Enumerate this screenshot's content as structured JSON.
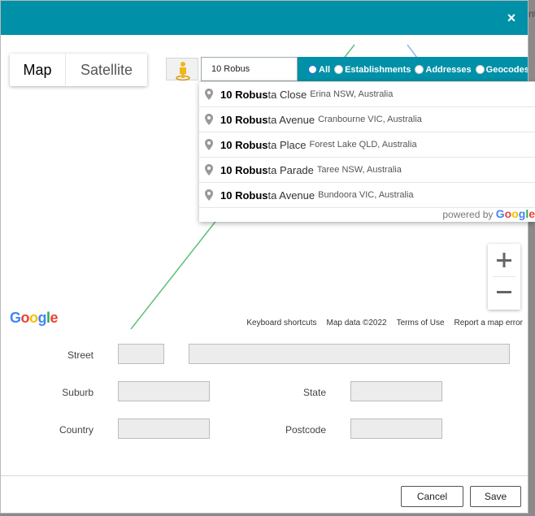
{
  "dialog": {
    "close_label": "×",
    "behind_text": "nt"
  },
  "map": {
    "maptype_map": "Map",
    "maptype_satellite": "Satellite",
    "zoom_in": "+",
    "zoom_out": "−",
    "footer": [
      "Keyboard shortcuts",
      "Map data ©2022",
      "Terms of Use",
      "Report a map error"
    ],
    "line_color": "#5cc07a"
  },
  "search": {
    "value": "10 Robus",
    "filters": [
      {
        "label": "All",
        "checked": true
      },
      {
        "label": "Establishments",
        "checked": false
      },
      {
        "label": "Addresses",
        "checked": false
      },
      {
        "label": "Geocodes",
        "checked": false
      }
    ]
  },
  "suggestions": [
    {
      "bold": "10 Robus",
      "rest": "ta Close",
      "secondary": "Erina NSW, Australia"
    },
    {
      "bold": "10 Robus",
      "rest": "ta Avenue",
      "secondary": "Cranbourne VIC, Australia"
    },
    {
      "bold": "10 Robus",
      "rest": "ta Place",
      "secondary": "Forest Lake QLD, Australia"
    },
    {
      "bold": "10 Robus",
      "rest": "ta Parade",
      "secondary": "Taree NSW, Australia"
    },
    {
      "bold": "10 Robus",
      "rest": "ta Avenue",
      "secondary": "Bundoora VIC, Australia"
    }
  ],
  "powered_by": {
    "prefix": "powered by",
    "brand": "Google"
  },
  "google_logo": {
    "letters": [
      "G",
      "o",
      "o",
      "g",
      "l",
      "e"
    ],
    "colors": [
      "#4285F4",
      "#EA4335",
      "#FBBC05",
      "#4285F4",
      "#34A853",
      "#EA4335"
    ]
  },
  "form": {
    "street_label": "Street",
    "suburb_label": "Suburb",
    "state_label": "State",
    "country_label": "Country",
    "postcode_label": "Postcode",
    "street_number": "",
    "street_name": "",
    "suburb": "",
    "state": "",
    "country": "",
    "postcode": ""
  },
  "buttons": {
    "cancel": "Cancel",
    "save": "Save"
  },
  "colors": {
    "header": "#0090a8"
  }
}
